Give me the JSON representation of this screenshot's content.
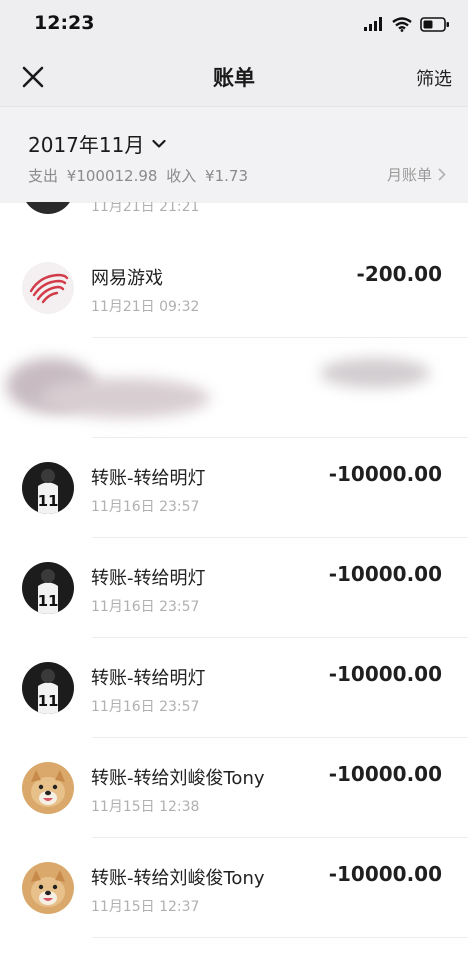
{
  "status_bar": {
    "time": "12:23"
  },
  "nav": {
    "title": "账单",
    "filter_label": "筛选"
  },
  "month_header": {
    "month": "2017年11月",
    "expense_label": "支出",
    "expense_value": "¥100012.98",
    "income_label": "收入",
    "income_value": "¥1.73",
    "monthly_bill_label": "月账单"
  },
  "partial_row": {
    "time": "11月21日 21:21"
  },
  "transactions": [
    {
      "title": "网易游戏",
      "time": "11月21日 09:32",
      "amount": "-200.00",
      "avatar": "netease-logo"
    },
    {
      "title": "",
      "time": "",
      "amount": "",
      "avatar": "blurred"
    },
    {
      "title": "转账-转给明灯",
      "time": "11月16日 23:57",
      "amount": "-10000.00",
      "avatar": "jersey-11"
    },
    {
      "title": "转账-转给明灯",
      "time": "11月16日 23:57",
      "amount": "-10000.00",
      "avatar": "jersey-11"
    },
    {
      "title": "转账-转给明灯",
      "time": "11月16日 23:57",
      "amount": "-10000.00",
      "avatar": "jersey-11"
    },
    {
      "title": "转账-转给刘峻俊Tony",
      "time": "11月15日 12:38",
      "amount": "-10000.00",
      "avatar": "dog-photo"
    },
    {
      "title": "转账-转给刘峻俊Tony",
      "time": "11月15日 12:37",
      "amount": "-10000.00",
      "avatar": "dog-photo"
    }
  ],
  "colors": {
    "nav_bg": "#eeeef1",
    "header_bg": "#f2f2f4",
    "text": "#1f1f1f",
    "muted": "#b0b0b0"
  }
}
